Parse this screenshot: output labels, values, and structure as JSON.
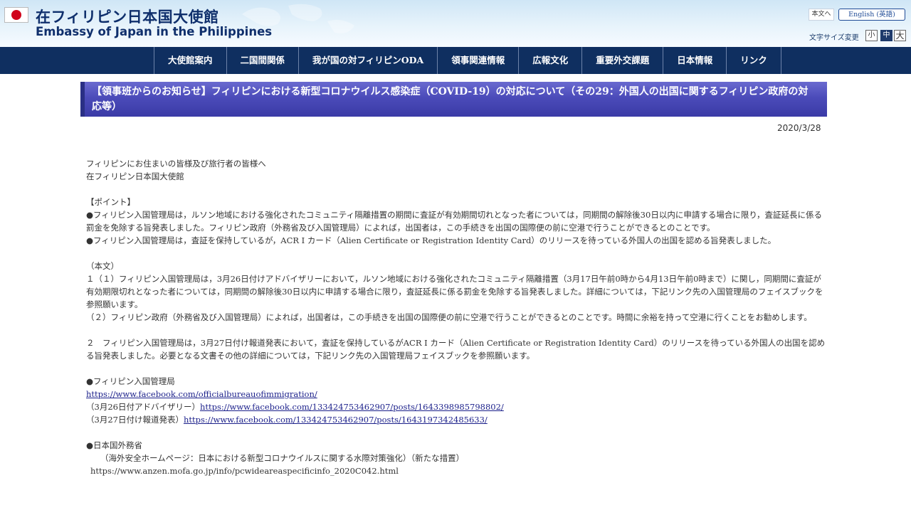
{
  "header": {
    "title_ja": "在フィリピン日本国大使館",
    "title_en": "Embassy of Japan in the Philippines",
    "main_content_link": "本文へ",
    "english_link": "English (英語)",
    "font_size_label": "文字サイズ変更",
    "font_sizes": [
      "小",
      "中",
      "大"
    ],
    "font_size_selected": "中",
    "flag_color": "#d0021b"
  },
  "nav": {
    "items": [
      "大使館案内",
      "二国間関係",
      "我が国の対フィリピンODA",
      "領事関連情報",
      "広報文化",
      "重要外交課題",
      "日本情報",
      "リンク"
    ]
  },
  "article": {
    "title": "【領事班からのお知らせ】フィリピンにおける新型コロナウイルス感染症（COVID-19）の対応について（その29：外国人の出国に関するフィリピン政府の対応等）",
    "date": "2020/3/28",
    "greeting_1": "フィリピンにお住まいの皆様及び旅行者の皆様へ",
    "greeting_2": "在フィリピン日本国大使館",
    "points_heading": "【ポイント】",
    "point_1": "●フィリピン入国管理局は，ルソン地域における強化されたコミュニティ隔離措置の期間に査証が有効期間切れとなった者については，同期間の解除後30日以内に申請する場合に限り，査証延長に係る罰金を免除する旨発表しました。フィリピン政府（外務省及び入国管理局）によれば，出国者は，この手続きを出国の国際便の前に空港で行うことができるとのことです。",
    "point_2": "●フィリピン入国管理局は，査証を保持しているが，ACR I カード（Alien Certificate or Registration Identity Card）のリリースを待っている外国人の出国を認める旨発表しました。",
    "body_heading": "（本文）",
    "body_1_1": "１（１）フィリピン入国管理局は，3月26日付けアドバイザリーにおいて，ルソン地域における強化されたコミュニティ隔離措置（3月17日午前0時から4月13日午前0時まで）に関し，同期間に査証が有効期限切れとなった者については，同期間の解除後30日以内に申請する場合に限り，査証延長に係る罰金を免除する旨発表しました。詳細については，下記リンク先の入国管理局のフェイスブックを参照願います。",
    "body_1_2": "（２）フィリピン政府（外務省及び入国管理局）によれば，出国者は，この手続きを出国の国際便の前に空港で行うことができるとのことです。時間に余裕を持って空港に行くことをお勧めします。",
    "body_2": "２　フィリピン入国管理局は，3月27日付け報道発表において，査証を保持しているがACR I カード（Alien Certificate or Registration Identity Card）のリリースを待っている外国人の出国を認める旨発表しました。必要となる文書その他の詳細については，下記リンク先の入国管理局フェイスブックを参照願います。",
    "bi_heading": "●フィリピン入国管理局",
    "bi_link": "https://www.facebook.com/officialbureauofimmigration/",
    "advisory_prefix": "（3月26日付アドバイザリー）",
    "advisory_link": "https://www.facebook.com/133424753462907/posts/1643398985798802/",
    "press_prefix": "（3月27日付け報道発表）",
    "press_link": "https://www.facebook.com/133424753462907/posts/1643197342485633/",
    "mofa_heading": "●日本国外務省",
    "mofa_desc": "（海外安全ホームページ：日本における新型コロナウイルスに関する水際対策強化）（新たな措置）",
    "mofa_url": "https://www.anzen.mofa.go.jp/info/pcwideareaspecificinfo_2020C042.html"
  }
}
